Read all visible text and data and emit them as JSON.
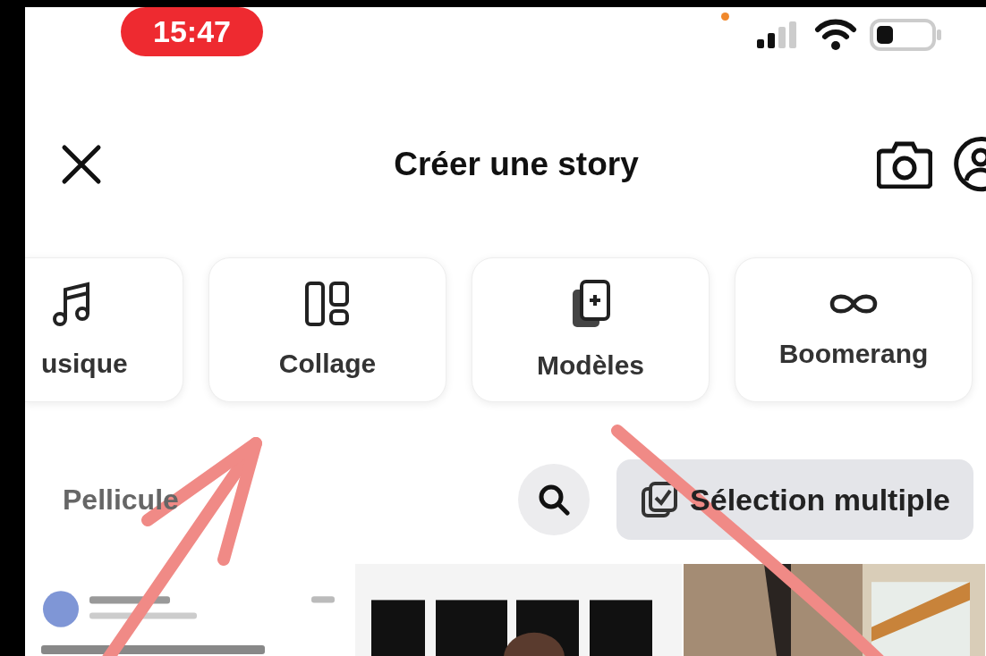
{
  "status_bar": {
    "time": "15:47"
  },
  "header": {
    "title": "Créer une story"
  },
  "modes": [
    {
      "label": "usique",
      "kind": "music",
      "cut": true
    },
    {
      "label": "Collage",
      "kind": "collage",
      "cut": false
    },
    {
      "label": "Modèles",
      "kind": "templates",
      "cut": false
    },
    {
      "label": "Boomerang",
      "kind": "infinity",
      "cut": false
    }
  ],
  "gallery": {
    "album": "Pellicule",
    "multi_select_label": "Sélection multiple",
    "tiles": [
      {
        "kind": "screenshot"
      },
      {
        "kind": "poster"
      },
      {
        "kind": "room"
      }
    ]
  }
}
